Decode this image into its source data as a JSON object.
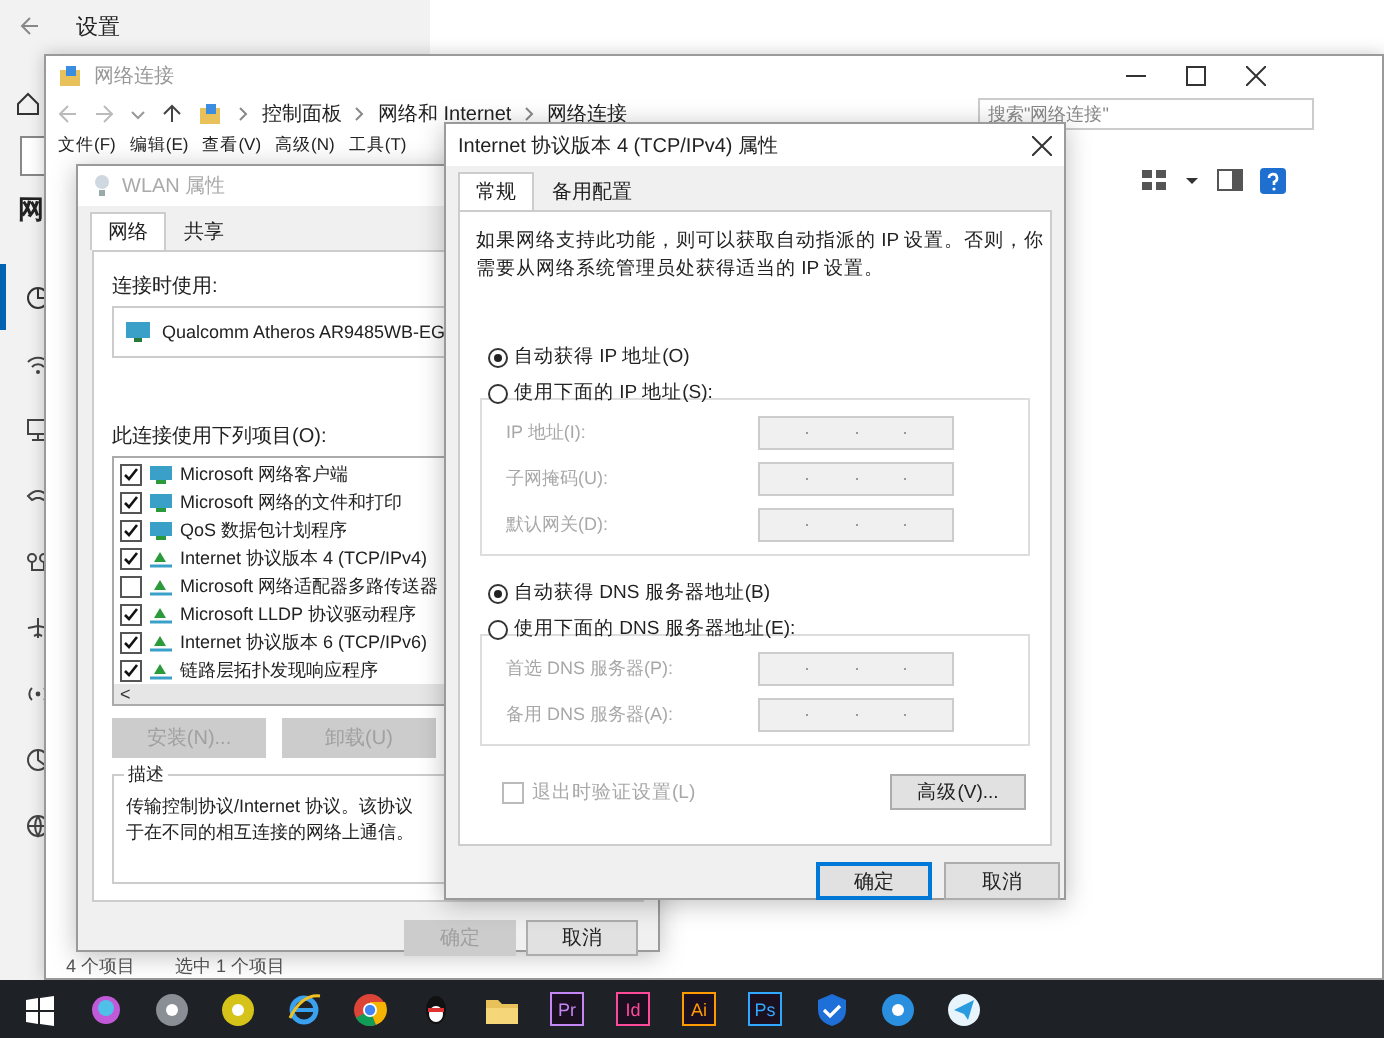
{
  "settings": {
    "title": "设置",
    "heading": "网",
    "sidebar_items": [
      {
        "kind": "status",
        "selected": true
      },
      {
        "kind": "wifi",
        "selected": false
      },
      {
        "kind": "ethernet",
        "selected": false
      },
      {
        "kind": "dialup",
        "selected": false
      },
      {
        "kind": "vpn",
        "selected": false
      },
      {
        "kind": "airplane",
        "selected": false
      },
      {
        "kind": "hotspot",
        "selected": false
      },
      {
        "kind": "usage",
        "selected": false
      },
      {
        "kind": "proxy",
        "selected": false
      }
    ]
  },
  "explorer": {
    "title": "网络连接",
    "breadcrumb": [
      "控制面板",
      "网络和 Internet",
      "网络连接"
    ],
    "search": {
      "placeholder": "搜索\"网络连接\""
    },
    "menu": [
      "文件(F)",
      "编辑(E)",
      "查看(V)",
      "高级(N)",
      "工具(T)"
    ],
    "status_bar": [
      "4 个项目",
      "选中 1 个项目"
    ]
  },
  "wlan": {
    "title": "WLAN 属性",
    "tabs": [
      {
        "label": "网络",
        "selected": true
      },
      {
        "label": "共享",
        "selected": false
      }
    ],
    "connect_using_label": "连接时使用:",
    "adapter": "Qualcomm Atheros AR9485WB-EG",
    "items_label": "此连接使用下列项目(O):",
    "items": [
      {
        "kind": "client",
        "label": "Microsoft 网络客户端",
        "checked": true
      },
      {
        "kind": "client",
        "label": "Microsoft 网络的文件和打印",
        "checked": true
      },
      {
        "kind": "client",
        "label": "QoS 数据包计划程序",
        "checked": true
      },
      {
        "kind": "protocol",
        "label": "Internet 协议版本 4 (TCP/IPv4)",
        "checked": true
      },
      {
        "kind": "protocol",
        "label": "Microsoft 网络适配器多路传送器",
        "checked": false
      },
      {
        "kind": "protocol",
        "label": "Microsoft LLDP 协议驱动程序",
        "checked": true
      },
      {
        "kind": "protocol",
        "label": "Internet 协议版本 6 (TCP/IPv6)",
        "checked": true
      },
      {
        "kind": "protocol",
        "label": "链路层拓扑发现响应程序",
        "checked": true
      }
    ],
    "scroll_arrow": "<",
    "item_buttons": [
      {
        "label": "安装(N)...",
        "disabled": true
      },
      {
        "label": "卸载(U)",
        "disabled": true
      }
    ],
    "description": {
      "title": "描述",
      "lines": [
        "传输控制协议/Internet 协议。该协议",
        "于在不同的相互连接的网络上通信。"
      ]
    },
    "buttons": [
      {
        "label": "确定",
        "disabled": true
      },
      {
        "label": "取消",
        "disabled": false
      }
    ]
  },
  "ipv4": {
    "title": "Internet 协议版本 4 (TCP/IPv4) 属性",
    "tabs": [
      {
        "label": "常规",
        "selected": true
      },
      {
        "label": "备用配置",
        "selected": false
      }
    ],
    "intro": "如果网络支持此功能，则可以获取自动指派的 IP 设置。否则，你需要从网络系统管理员处获得适当的 IP 设置。",
    "ip_options": [
      {
        "label": "自动获得 IP 地址(O)",
        "selected": true
      },
      {
        "label": "使用下面的 IP 地址(S):",
        "selected": false
      }
    ],
    "ip_fields": [
      {
        "label": "IP 地址(I):",
        "disabled": true
      },
      {
        "label": "子网掩码(U):",
        "disabled": true
      },
      {
        "label": "默认网关(D):",
        "disabled": true
      }
    ],
    "dns_options": [
      {
        "label": "自动获得 DNS 服务器地址(B)",
        "selected": true
      },
      {
        "label": "使用下面的 DNS 服务器地址(E):",
        "selected": false
      }
    ],
    "dns_fields": [
      {
        "label": "首选 DNS 服务器(P):",
        "disabled": true
      },
      {
        "label": "备用 DNS 服务器(A):",
        "disabled": true
      }
    ],
    "validate": {
      "label": "退出时验证设置(L)",
      "checked": false,
      "disabled": true
    },
    "advanced": "高级(V)...",
    "buttons": [
      {
        "label": "确定",
        "kind": "default"
      },
      {
        "label": "取消",
        "kind": "normal"
      }
    ]
  },
  "taskbar": {
    "apps": [
      {
        "kind": "start"
      },
      {
        "kind": "orb"
      },
      {
        "kind": "round",
        "color": "#8a8f96"
      },
      {
        "kind": "round",
        "color": "#d6c31a"
      },
      {
        "kind": "ie"
      },
      {
        "kind": "chrome"
      },
      {
        "kind": "penguin"
      },
      {
        "kind": "folder"
      },
      {
        "kind": "letter",
        "label": "Pr",
        "color": "#c586f5"
      },
      {
        "kind": "letter",
        "label": "Id",
        "color": "#ff4a9a"
      },
      {
        "kind": "letter",
        "label": "Ai",
        "color": "#ff9a00"
      },
      {
        "kind": "letter",
        "label": "Ps",
        "color": "#31a8ff"
      },
      {
        "kind": "shield"
      },
      {
        "kind": "round",
        "color": "#2b8fe0"
      },
      {
        "kind": "plane"
      }
    ]
  }
}
